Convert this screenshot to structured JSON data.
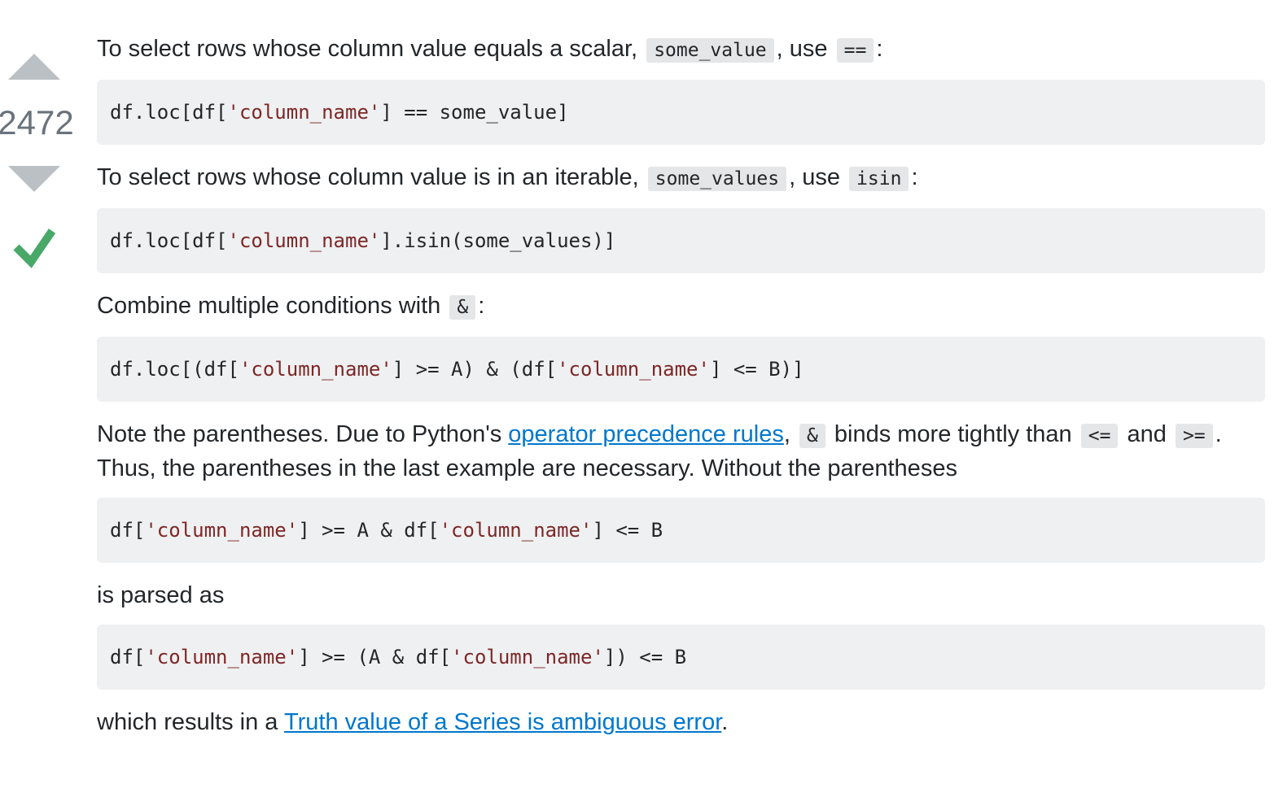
{
  "vote": {
    "count": "2472",
    "accepted": true
  },
  "colors": {
    "accepted_green": "#48a868",
    "arrow_gray": "#bbc0c4",
    "link_blue": "#0077cc",
    "string_red": "#7d2727"
  },
  "icons": {
    "upvote": "triangle-up-icon",
    "downvote": "triangle-down-icon",
    "accepted": "checkmark-icon"
  },
  "p1": {
    "text_a": "To select rows whose column value equals a scalar,",
    "code_a": "some_value",
    "text_b": ", use",
    "code_b": "==",
    "text_c": ":"
  },
  "code1": {
    "t1": "df.loc[df[",
    "s1": "'column_name'",
    "t2": "] == some_value]"
  },
  "p2": {
    "text_a": "To select rows whose column value is in an iterable,",
    "code_a": "some_values",
    "text_b": ", use",
    "code_b": "isin",
    "text_c": ":"
  },
  "code2": {
    "t1": "df.loc[df[",
    "s1": "'column_name'",
    "t2": "].isin(some_values)]"
  },
  "p3": {
    "text_a": "Combine multiple conditions with",
    "code_a": "&",
    "text_b": ":"
  },
  "code3": {
    "t1": "df.loc[(df[",
    "s1": "'column_name'",
    "t2": "] >= A) & (df[",
    "s2": "'column_name'",
    "t3": "] <= B)]"
  },
  "p4": {
    "text_a": "Note the parentheses. Due to Python's",
    "link": "operator precedence rules",
    "text_b": ",",
    "code_a": "&",
    "text_c": "binds more tightly than",
    "code_b": "<=",
    "text_d": "and",
    "code_c": ">=",
    "text_e": ".",
    "text_f": "Thus, the parentheses in the last example are necessary. Without the parentheses"
  },
  "code4": {
    "t1": "df[",
    "s1": "'column_name'",
    "t2": "] >= A & df[",
    "s2": "'column_name'",
    "t3": "] <= B"
  },
  "p5": {
    "text_a": "is parsed as"
  },
  "code5": {
    "t1": "df[",
    "s1": "'column_name'",
    "t2": "] >= (A & df[",
    "s2": "'column_name'",
    "t3": "]) <= B"
  },
  "p6": {
    "text_a": "which results in a",
    "link": "Truth value of a Series is ambiguous error",
    "text_b": "."
  }
}
